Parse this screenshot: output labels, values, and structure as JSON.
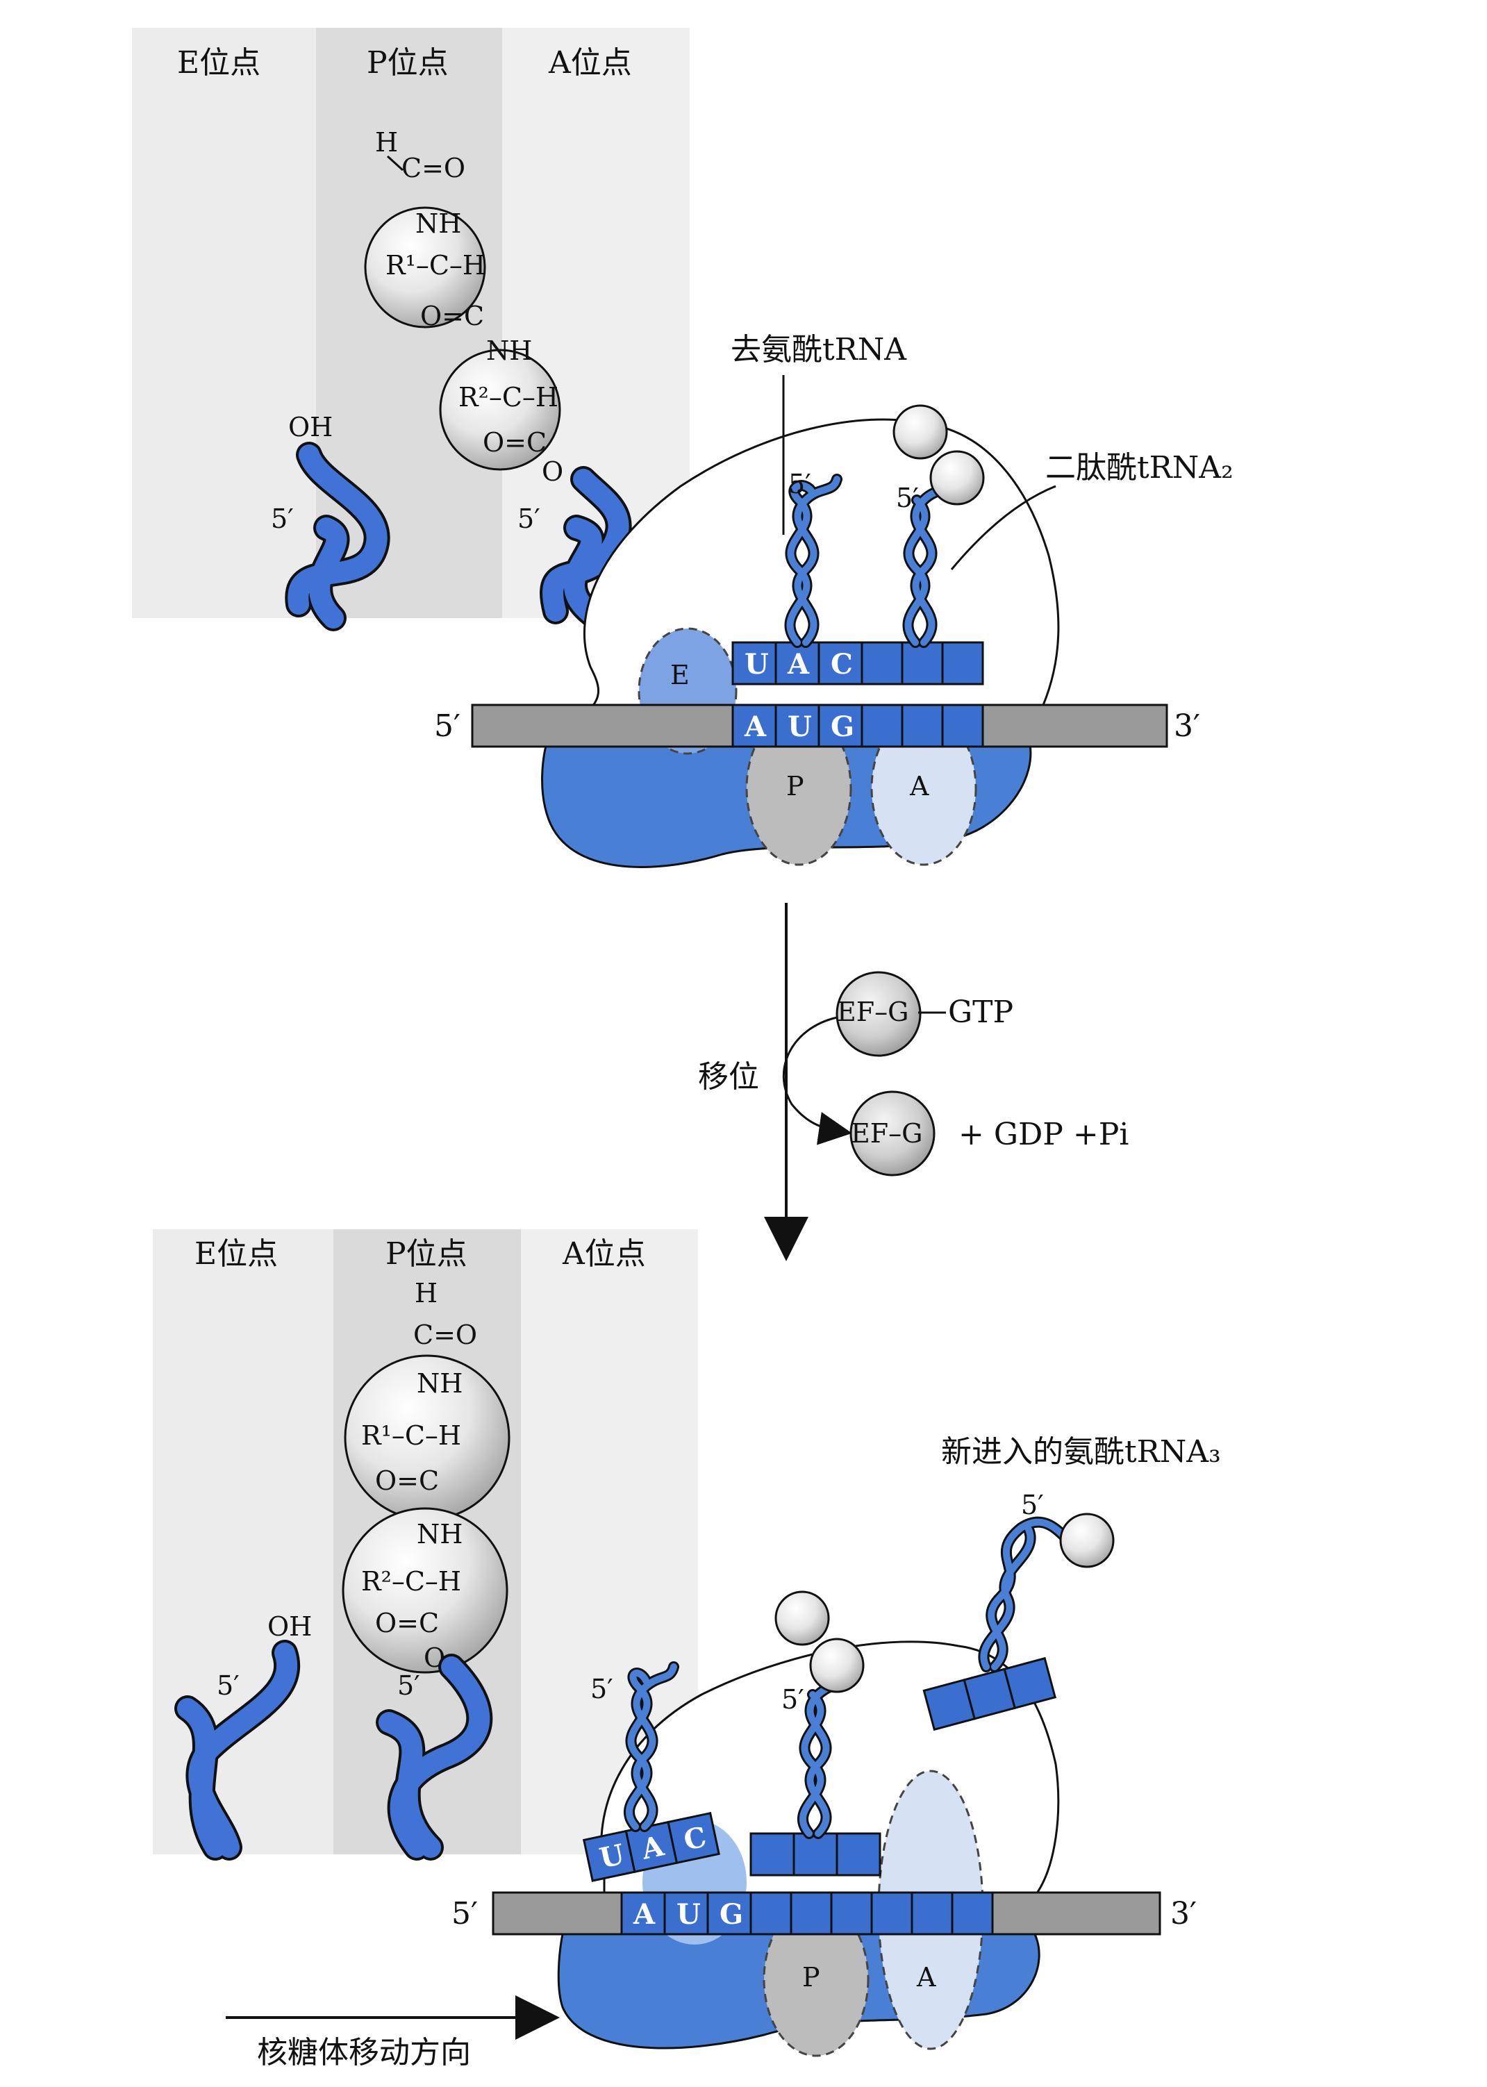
{
  "top_panel": {
    "site_headers": {
      "e": "E位点",
      "p": "P位点",
      "a": "A位点"
    },
    "chem": {
      "formyl_h": "H",
      "formyl_co": "C=O",
      "nh1": "NH",
      "r1_group": "R¹–C–H",
      "co1": "O=C",
      "nh2": "NH",
      "r2_group": "R²–C–H",
      "co2": "O=C",
      "ester_o": "O",
      "oh": "OH",
      "five_prime_e": "5′",
      "five_prime_p": "5′"
    }
  },
  "ribosome_top": {
    "label_deacyl": "去氨酰tRNA",
    "label_dipeptidyl": "二肽酰tRNA₂",
    "trna_p_5prime": "5′",
    "trna_a_5prime": "5′",
    "anticodon": [
      "U",
      "A",
      "C"
    ],
    "codon": [
      "A",
      "U",
      "G"
    ],
    "mrna_5prime": "5′",
    "mrna_3prime": "3′",
    "site_e": "E",
    "site_p": "P",
    "site_a": "A"
  },
  "translocation": {
    "label": "移位",
    "ef_g_top": "EF–G",
    "gtp": "GTP",
    "ef_g_bottom": "EF–G",
    "products": "+ GDP +Pi"
  },
  "bottom_panel": {
    "site_headers": {
      "e": "E位点",
      "p": "P位点",
      "a": "A位点"
    },
    "chem": {
      "formyl_h": "H",
      "formyl_co": "C=O",
      "nh1": "NH",
      "r1_group": "R¹–C–H",
      "co1": "O=C",
      "nh2": "NH",
      "r2_group": "R²–C–H",
      "co2": "O=C",
      "ester_o": "O",
      "oh": "OH",
      "five_prime_e": "5′",
      "five_prime_p": "5′"
    }
  },
  "ribosome_bottom": {
    "label_incoming": "新进入的氨酰tRNA₃",
    "trna_e_5prime": "5′",
    "trna_p_5prime": "5′",
    "trna_new_5prime": "5′",
    "anticodon": [
      "U",
      "A",
      "C"
    ],
    "codon": [
      "A",
      "U",
      "G"
    ],
    "mrna_5prime": "5′",
    "mrna_3prime": "3′",
    "site_p": "P",
    "site_a": "A",
    "direction_label": "核糖体移动方向"
  },
  "colors": {
    "ribosome_blue": "#4a7fd6",
    "site_light_blue": "#9fc0ee",
    "site_pale": "#d6e2f3",
    "codon_blue": "#3a6fd0",
    "mrna_gray": "#9a9a9a",
    "panel_gray": "#ececec",
    "panel_p_gray": "#dadada",
    "trna_blue": "#3d6fd8",
    "site_gray": "#bdbdbd"
  }
}
